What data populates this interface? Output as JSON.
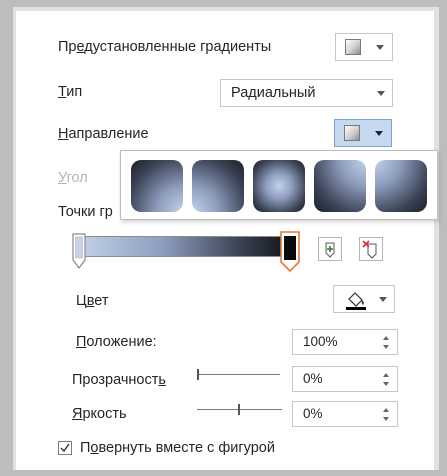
{
  "presets": {
    "label": "Предустановленные градиенты"
  },
  "type": {
    "label": "Тип",
    "value": "Радиальный"
  },
  "direction": {
    "label": "Направление"
  },
  "angle": {
    "label": "Угол"
  },
  "stops": {
    "label": "Точки гр"
  },
  "gradient_bar": {
    "colors": [
      "#c4d2ea",
      "#8d9dbd",
      "#3b4355",
      "#0e1015"
    ],
    "stop_positions_percent": [
      0,
      100
    ]
  },
  "direction_variants": [
    {
      "name": "from-bottom-right",
      "center": "100% 100%"
    },
    {
      "name": "from-bottom-left",
      "center": "0% 100%"
    },
    {
      "name": "from-center",
      "center": "50% 50%"
    },
    {
      "name": "from-top-right",
      "center": "100% 0%"
    },
    {
      "name": "from-top-left",
      "center": "0% 0%"
    }
  ],
  "color": {
    "label": "Цвет"
  },
  "position": {
    "label": "Положение:",
    "value": "100%"
  },
  "transparency": {
    "label": "Прозрачность",
    "value": "0%"
  },
  "brightness": {
    "label": "Яркость",
    "value": "0%"
  },
  "rotate": {
    "label": "Повернуть вместе с фигурой",
    "checked": true
  },
  "colors": {
    "selected_stop": "#e07b39",
    "popup_hover": "#c5d9f1"
  }
}
